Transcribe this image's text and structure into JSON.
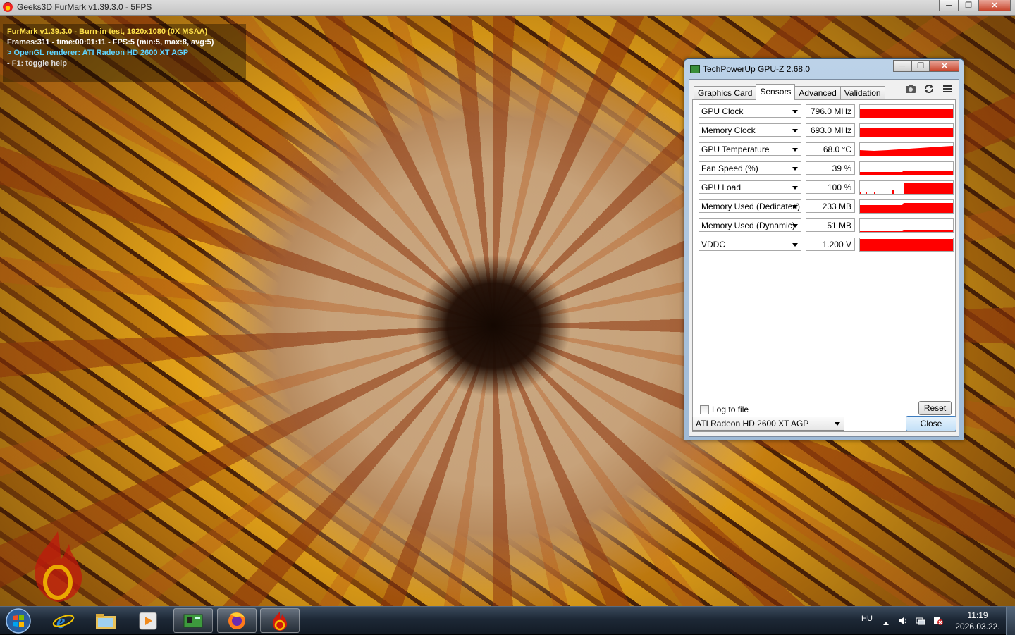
{
  "furmark": {
    "window_title": "Geeks3D FurMark v1.39.3.0 - 5FPS",
    "overlay": {
      "line1": "FurMark v1.39.3.0 - Burn-in test, 1920x1080 (0X MSAA)",
      "line2": "Frames:311 - time:00:01:11 - FPS:5 (min:5, max:8, avg:5)",
      "line3": "> OpenGL renderer: ATI Radeon HD 2600 XT AGP",
      "line4": "- F1: toggle help"
    },
    "icons": [
      "furmark-icon",
      "minimize-icon",
      "maximize-icon",
      "close-icon"
    ]
  },
  "gpuz": {
    "window_title": "TechPowerUp GPU-Z 2.68.0",
    "tabs": [
      {
        "label": "Graphics Card"
      },
      {
        "label": "Sensors"
      },
      {
        "label": "Advanced"
      },
      {
        "label": "Validation"
      }
    ],
    "active_tab": "Sensors",
    "tool_icons": [
      "camera-icon",
      "refresh-icon",
      "menu-icon"
    ],
    "sensors": [
      {
        "name": "GPU Clock",
        "value": "796.0 MHz"
      },
      {
        "name": "Memory Clock",
        "value": "693.0 MHz"
      },
      {
        "name": "GPU Temperature",
        "value": "68.0 °C"
      },
      {
        "name": "Fan Speed (%)",
        "value": "39 %"
      },
      {
        "name": "GPU Load",
        "value": "100 %"
      },
      {
        "name": "Memory Used (Dedicated)",
        "value": "233 MB"
      },
      {
        "name": "Memory Used (Dynamic)",
        "value": "51 MB"
      },
      {
        "name": "VDDC",
        "value": "1.200 V"
      }
    ],
    "graph_color": "#ff0000",
    "log_to_file_label": "Log to file",
    "log_to_file_checked": false,
    "reset_label": "Reset",
    "gpu_selected": "ATI Radeon HD 2600 XT AGP",
    "close_label": "Close"
  },
  "taskbar": {
    "apps": [
      "windows-start-icon",
      "internet-explorer-icon",
      "file-explorer-icon",
      "media-player-icon",
      "gpuz-taskbar-icon",
      "firefox-icon",
      "furmark-taskbar-icon"
    ],
    "language": "HU",
    "time": "11:19",
    "date": "2026.03.22."
  }
}
